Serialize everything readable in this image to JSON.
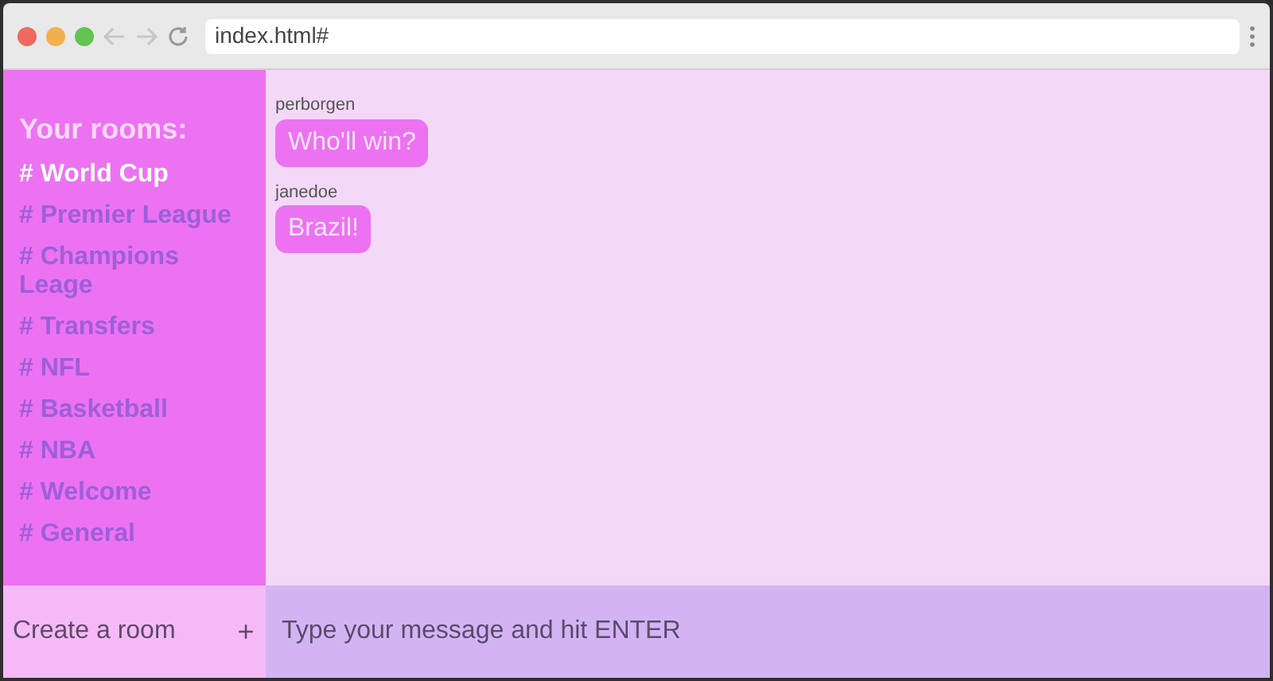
{
  "browser": {
    "address": "index.html#"
  },
  "sidebar": {
    "title": "Your rooms:",
    "rooms": [
      {
        "label": "# World Cup",
        "selected": true
      },
      {
        "label": "# Premier League",
        "selected": false
      },
      {
        "label": "# Champions Leage",
        "selected": false
      },
      {
        "label": "# Transfers",
        "selected": false
      },
      {
        "label": "# NFL",
        "selected": false
      },
      {
        "label": "# Basketball",
        "selected": false
      },
      {
        "label": "# NBA",
        "selected": false
      },
      {
        "label": "# Welcome",
        "selected": false
      },
      {
        "label": "# General",
        "selected": false
      }
    ]
  },
  "messages": [
    {
      "sender": "perborgen",
      "text": "Who'll win?"
    },
    {
      "sender": "janedoe",
      "text": "Brazil!"
    }
  ],
  "create_room": {
    "placeholder": "Create a room",
    "button": "+"
  },
  "message_input": {
    "placeholder": "Type your message and hit ENTER"
  }
}
